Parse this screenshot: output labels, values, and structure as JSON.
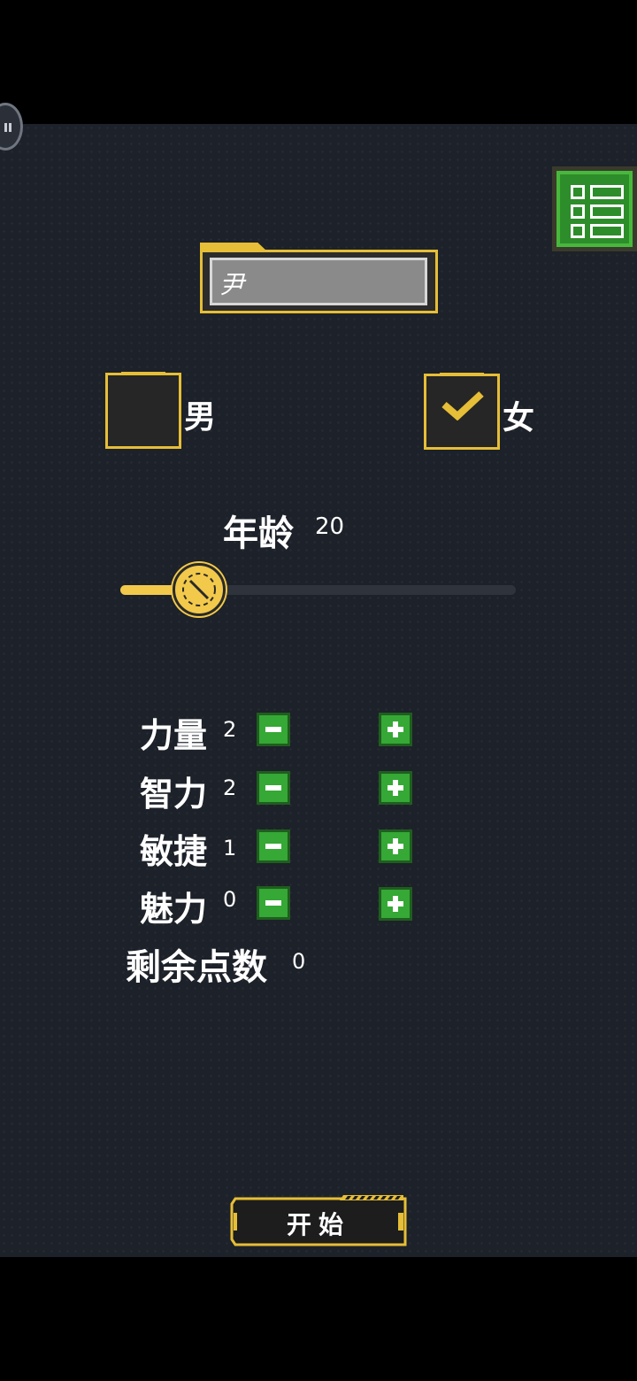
{
  "name_field": {
    "value": "尹"
  },
  "gender": {
    "male_label": "男",
    "female_label": "女",
    "selected": "female"
  },
  "age": {
    "label": "年龄",
    "value": "20",
    "slider_level_percent": 20
  },
  "stats": [
    {
      "label": "力量",
      "value": "2"
    },
    {
      "label": "智力",
      "value": "2"
    },
    {
      "label": "敏捷",
      "value": "1"
    },
    {
      "label": "魅力",
      "value": "0"
    }
  ],
  "remaining": {
    "label": "剩余点数",
    "value": "0"
  },
  "start_button": {
    "label": "开始"
  },
  "icons": {
    "menu": "list-menu-icon",
    "float": "pause-float-icon",
    "check": "check-icon",
    "minus": "minus-icon",
    "plus": "plus-icon",
    "slider_knob": "slider-knob-icon"
  },
  "colors": {
    "accent_gold": "#e6be37",
    "button_green": "#35a835",
    "background": "#1d2129"
  }
}
